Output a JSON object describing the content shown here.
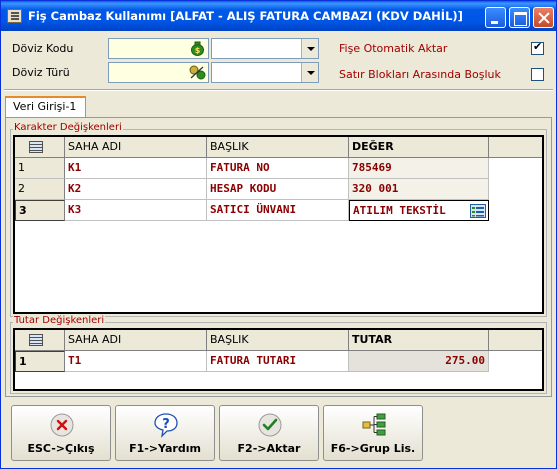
{
  "window": {
    "title": "Fiş Cambaz Kullanımı [ALFAT - ALIŞ FATURA CAMBAZI (KDV DAHİL)]"
  },
  "form": {
    "doviz_kodu_label": "Döviz Kodu",
    "doviz_kodu_value": "",
    "doviz_turu_label": "Döviz Türü",
    "doviz_turu_value": "",
    "fise_otomatik_aktar_label": "Fişe Otomatik Aktar",
    "fise_otomatik_aktar_checked": true,
    "satir_bosluk_label": "Satır Blokları Arasında Boşluk",
    "satir_bosluk_checked": false
  },
  "tabs": [
    {
      "label": "Veri Girişi-1"
    }
  ],
  "karakter": {
    "group_label": "Karakter Değişkenleri",
    "headers": {
      "saha": "SAHA ADI",
      "baslik": "BAŞLIK",
      "deger": "DEĞER"
    },
    "rows": [
      {
        "num": "1",
        "saha": "K1",
        "baslik": "FATURA NO",
        "deger": "785469"
      },
      {
        "num": "2",
        "saha": "K2",
        "baslik": "HESAP KODU",
        "deger": "320 001"
      },
      {
        "num": "3",
        "saha": "K3",
        "baslik": "SATICI ÜNVANI",
        "deger": "ATILIM TEKSTİL"
      }
    ]
  },
  "tutar": {
    "group_label": "Tutar Değişkenleri",
    "headers": {
      "saha": "SAHA ADI",
      "baslik": "BAŞLIK",
      "tutar": "TUTAR"
    },
    "rows": [
      {
        "num": "1",
        "saha": "T1",
        "baslik": "FATURA TUTARI",
        "tutar": "275.00"
      }
    ]
  },
  "buttons": {
    "exit": "ESC->Çıkış",
    "help": "F1->Yardım",
    "transfer": "F2->Aktar",
    "group_list": "F6->Grup Lis."
  },
  "colors": {
    "titlebar": "#0055E5",
    "data_text": "#8B0000",
    "field_bg": "#FFFFE1",
    "label_red": "#A00000"
  }
}
